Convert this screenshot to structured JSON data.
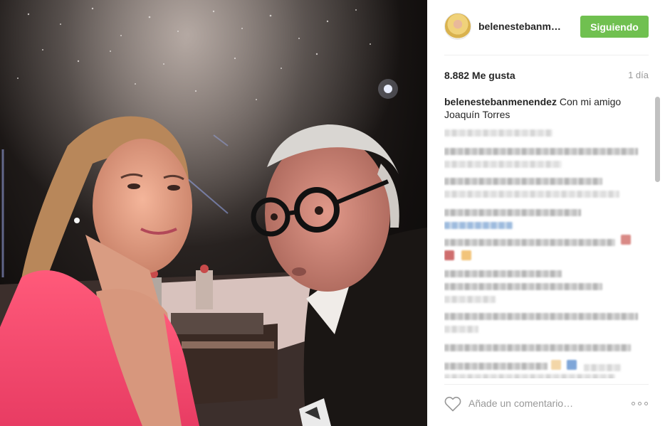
{
  "post": {
    "username": "belenestebanmenendez",
    "username_short": "belenestebanm…",
    "follow_label": "Siguiendo",
    "likes": "8.882 Me gusta",
    "time": "1 día",
    "caption": "Con mi amigo Joaquín Torres"
  },
  "footer": {
    "comment_placeholder": "Añade un comentario…",
    "like_icon": "heart-outline-icon",
    "more_icon": "more-options-icon"
  },
  "colors": {
    "follow_button": "#70c050",
    "secondary_text": "#999999",
    "divider": "#efefef"
  }
}
